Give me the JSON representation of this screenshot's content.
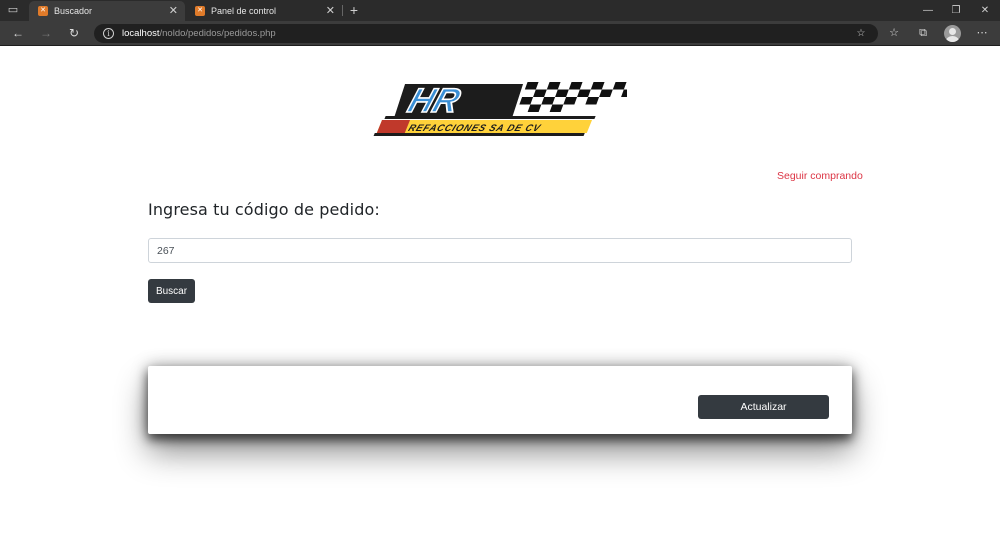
{
  "browser": {
    "tabs": [
      {
        "title": "Buscador",
        "active": true
      },
      {
        "title": "Panel de control",
        "active": false
      }
    ],
    "address": {
      "host": "localhost",
      "path": "/noldo/pedidos/pedidos.php"
    },
    "icons": {
      "tab_actions": "tab-actions-icon",
      "favicon": "xampp-favicon",
      "close": "close-icon",
      "new_tab": "plus-icon",
      "back": "back-arrow-icon",
      "forward": "forward-arrow-icon",
      "refresh": "refresh-icon",
      "site_info": "info-icon",
      "add_favorite": "star-plus-icon",
      "favorites": "favorites-icon",
      "collections": "collections-icon",
      "profile": "avatar",
      "menu": "more-icon"
    }
  },
  "page": {
    "logo": {
      "main_text": "HR",
      "subtitle": "REFACCIONES SA DE CV"
    },
    "seguir_link": "Seguir comprando",
    "heading": "Ingresa tu código de pedido:",
    "code_input": {
      "value": "267"
    },
    "buscar_button": "Buscar",
    "actualizar_button": "Actualizar"
  },
  "colors": {
    "link_red": "#dc3545",
    "button_dark": "#343a40",
    "text_dark": "#212529",
    "chrome_bg": "#2b2b2b"
  }
}
